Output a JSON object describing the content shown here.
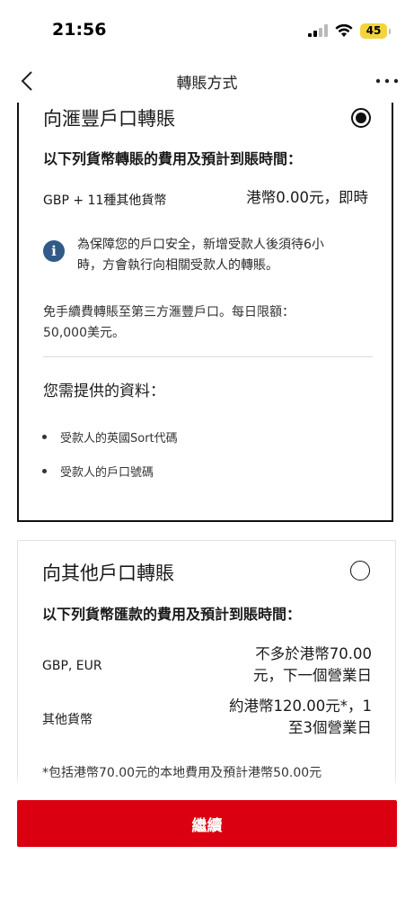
{
  "status": {
    "time": "21:56",
    "battery": "45"
  },
  "nav": {
    "title": "轉賬方式"
  },
  "hsbc_option": {
    "title": "向滙豐戶口轉賬",
    "selected": true,
    "fee_heading": "以下列貨幣轉賬的費用及預計到賬時間：",
    "rows": [
      {
        "currency": "GBP + 11種其他貨幣",
        "value": "港幣0.00元，即時"
      }
    ],
    "info_line1": "為保障您的戶口安全，新增受款人後須待6小",
    "info_line2": "時，方會執行向相關受款人的轉賬。",
    "free_line1": "免手續費轉賬至第三方滙豐戶口。每日限額：",
    "free_line2": "50,000美元。",
    "required_heading": "您需提供的資料：",
    "required_items": [
      "受款人的英國Sort代碼",
      "受款人的戶口號碼"
    ]
  },
  "other_option": {
    "title": "向其他戶口轉賬",
    "selected": false,
    "fee_heading": "以下列貨幣匯款的費用及預計到賬時間：",
    "rows": [
      {
        "currency": "GBP, EUR",
        "value_line1": "不多於港幣70.00",
        "value_line2": "元，下一個營業日"
      },
      {
        "currency": "其他貨幣",
        "value_line1": "約港幣120.00元*，1",
        "value_line2": "至3個營業日"
      }
    ],
    "footnote": "*包括港幣70.00元的本地費用及預計港幣50.00元"
  },
  "footer": {
    "continue_label": "繼續"
  },
  "colors": {
    "accent": "#db0011",
    "info": "#305a87",
    "battery": "#f5d33d"
  }
}
